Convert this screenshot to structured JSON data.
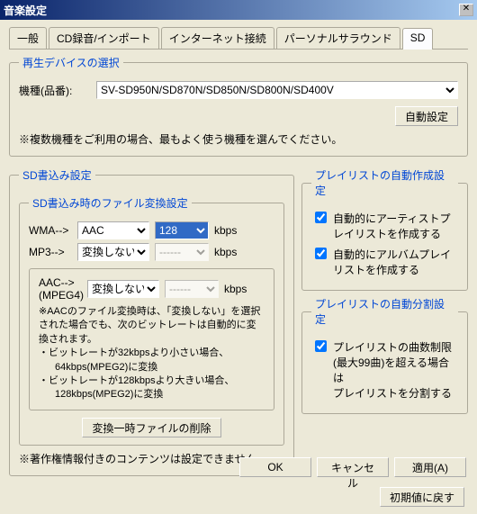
{
  "window": {
    "title": "音楽設定"
  },
  "tabs": {
    "items": [
      "一般",
      "CD録音/インポート",
      "インターネット接続",
      "パーソナルサラウンド",
      "SD"
    ],
    "active": "SD"
  },
  "device": {
    "legend": "再生デバイスの選択",
    "label": "機種(品番):",
    "selected": "SV-SD950N/SD870N/SD850N/SD800N/SD400V",
    "auto_btn": "自動設定",
    "note": "※複数機種をご利用の場合、最もよく使う機種を選んでください。"
  },
  "sdwrite": {
    "legend": "SD書込み設定",
    "convert": {
      "legend": "SD書込み時のファイル変換設定",
      "wma_label": "WMA-->",
      "wma_format": "AAC",
      "wma_bitrate": "128",
      "kbps": "kbps",
      "mp3_label": "MP3-->",
      "mp3_format": "変換しない",
      "mp3_bitrate": "------",
      "aac": {
        "label1": "AAC-->",
        "label2": "(MPEG4)",
        "format": "変換しない",
        "bitrate": "------",
        "note1": "※AACのファイル変換時は、「変換しない」を選択された場合でも、次のビットレートは自動的に変換されます。",
        "bullet1": "・ビットレートが32kbpsより小さい場合、",
        "bullet1b": "64kbps(MPEG2)に変換",
        "bullet2": "・ビットレートが128kbpsより大きい場合、",
        "bullet2b": "128kbps(MPEG2)に変換"
      },
      "delete_btn": "変換一時ファイルの削除"
    },
    "copyright_note": "※著作権情報付きのコンテンツは設定できません。"
  },
  "playlist_auto": {
    "legend": "プレイリストの自動作成設定",
    "chk1": "自動的にアーティストプレイリストを作成する",
    "chk2": "自動的にアルバムプレイリストを作成する"
  },
  "playlist_split": {
    "legend": "プレイリストの自動分割設定",
    "chk1_l1": "プレイリストの曲数制限",
    "chk1_l2": "(最大99曲)を超える場合は",
    "chk1_l3": "プレイリストを分割する"
  },
  "buttons": {
    "reset": "初期値に戻す",
    "ok": "OK",
    "cancel": "キャンセル",
    "apply": "適用(A)"
  }
}
